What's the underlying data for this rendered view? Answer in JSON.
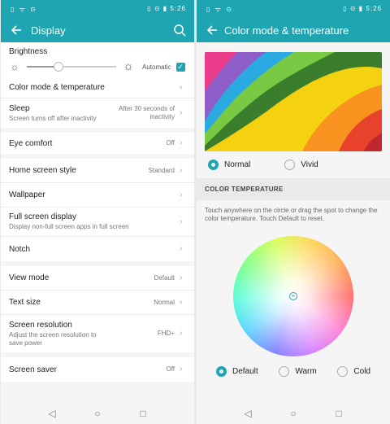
{
  "status": {
    "left": "▯ ᯤ ⊙",
    "time": "5:26",
    "right_icons": "▯ ⊙ ▮"
  },
  "display": {
    "title": "Display",
    "brightness": {
      "label": "Brightness",
      "automatic_label": "Automatic",
      "level": 0.35,
      "automatic_checked": true
    },
    "items": [
      {
        "label": "Color mode & temperature"
      },
      {
        "label": "Sleep",
        "sub": "Screen turns off after inactivity",
        "value": "After 30 seconds of inactivity"
      },
      {
        "label": "Eye comfort",
        "value": "Off"
      },
      {
        "label": "Home screen style",
        "value": "Standard"
      },
      {
        "label": "Wallpaper"
      },
      {
        "label": "Full screen display",
        "sub": "Display non-full screen apps in full screen"
      },
      {
        "label": "Notch"
      },
      {
        "label": "View mode",
        "value": "Default"
      },
      {
        "label": "Text size",
        "value": "Normal"
      },
      {
        "label": "Screen resolution",
        "sub": "Adjust the screen resolution to save power",
        "value": "FHD+"
      },
      {
        "label": "Screen saver",
        "value": "Off"
      }
    ]
  },
  "color": {
    "title": "Color mode & temperature",
    "modes": [
      {
        "label": "Normal",
        "selected": true
      },
      {
        "label": "Vivid",
        "selected": false
      }
    ],
    "section": "COLOR TEMPERATURE",
    "hint": "Touch anywhere on the circle or drag the spot to change the color temperature. Touch Default to reset.",
    "temps": [
      {
        "label": "Default",
        "selected": true
      },
      {
        "label": "Warm",
        "selected": false
      },
      {
        "label": "Cold",
        "selected": false
      }
    ]
  },
  "colors": {
    "accent": "#1fa5b1"
  }
}
